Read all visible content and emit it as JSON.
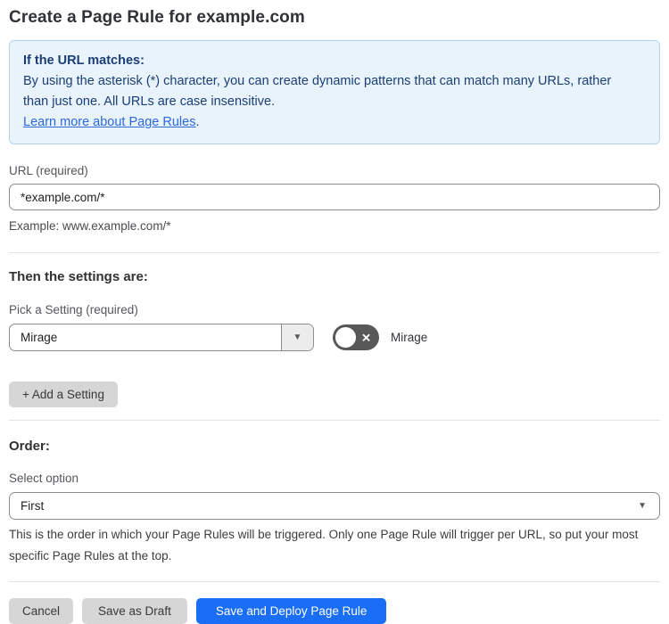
{
  "page": {
    "title": "Create a Page Rule for example.com"
  },
  "info_box": {
    "heading": "If the URL matches:",
    "body": "By using the asterisk (*) character, you can create dynamic patterns that can match many URLs, rather than just one. All URLs are case insensitive.",
    "link_label": "Learn more about Page Rules",
    "link_suffix": "."
  },
  "url_field": {
    "label": "URL (required)",
    "value": "*example.com/*",
    "helper": "Example: www.example.com/*"
  },
  "settings_section": {
    "heading": "Then the settings are:",
    "picker_label": "Pick a Setting (required)",
    "picker_value": "Mirage",
    "toggle_label": "Mirage",
    "toggle_state": "off",
    "toggle_icon": "✕",
    "caret": "▼",
    "add_button_label": "+ Add a Setting"
  },
  "order_section": {
    "heading": "Order:",
    "select_label": "Select option",
    "select_value": "First",
    "caret": "▼",
    "helper": "This is the order in which your Page Rules will be triggered. Only one Page Rule will trigger per URL, so put your most specific Page Rules at the top."
  },
  "footer": {
    "cancel_label": "Cancel",
    "save_draft_label": "Save as Draft",
    "save_deploy_label": "Save and Deploy Page Rule"
  },
  "colors": {
    "accent_blue": "#1a6ef5",
    "info_bg": "#e9f3fc",
    "info_border": "#b3d3f1",
    "info_text": "#1b3e75",
    "link_blue": "#2c68d9",
    "toggle_off_gray": "#585858",
    "button_gray": "#d6d6d6"
  }
}
